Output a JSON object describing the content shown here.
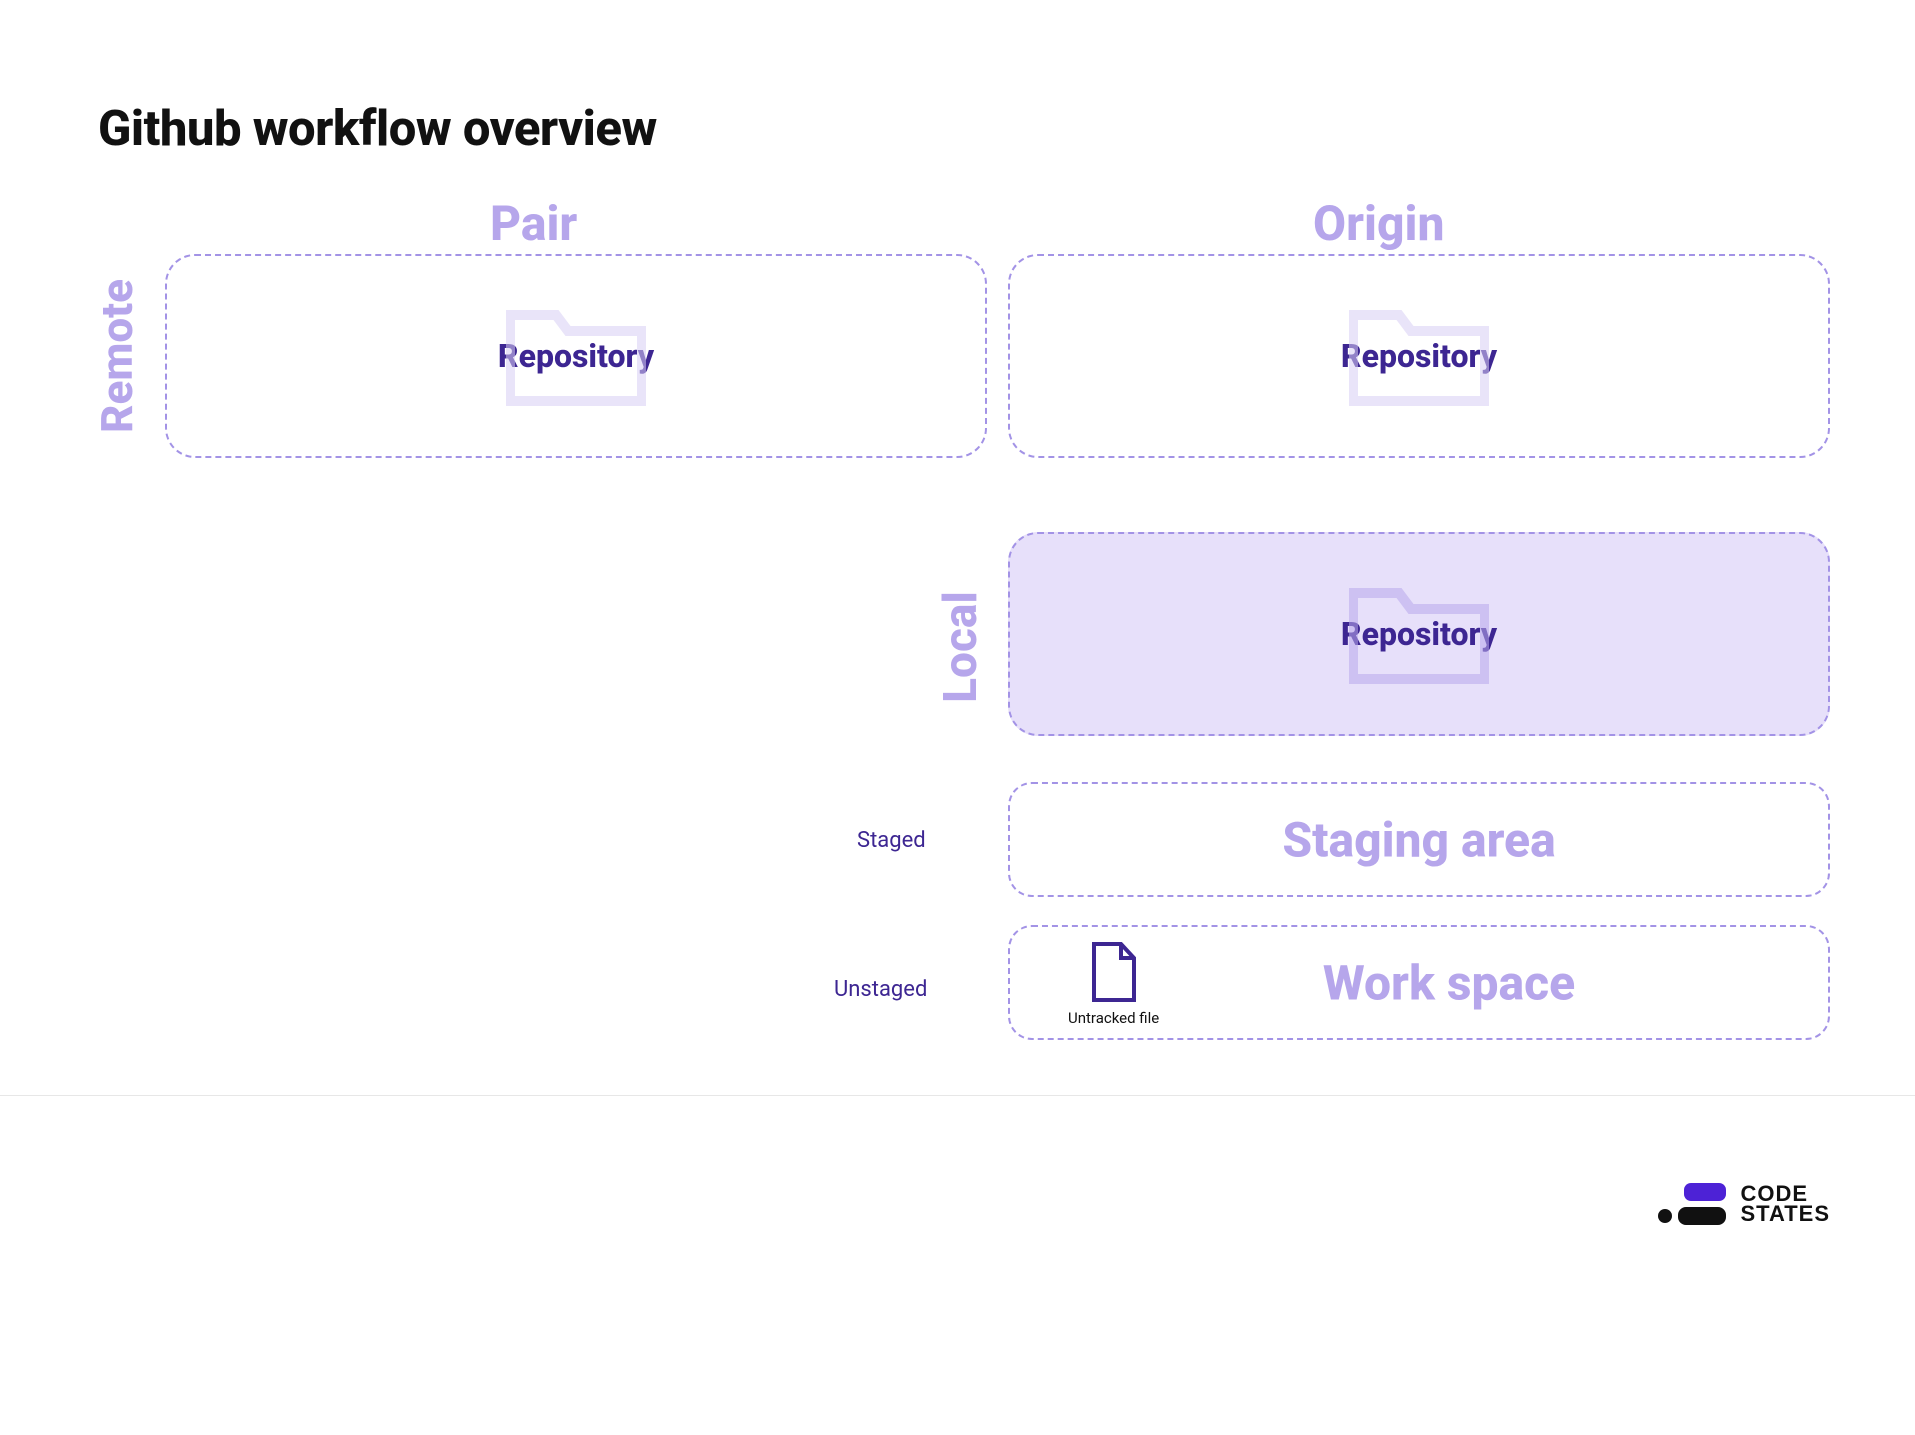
{
  "title": "Github workflow overview",
  "labels": {
    "remote": "Remote",
    "local": "Local",
    "pair": "Pair",
    "origin": "Origin",
    "staged": "Staged",
    "unstaged": "Unstaged"
  },
  "boxes": {
    "pair_repo": "Repository",
    "origin_repo": "Repository",
    "local_repo": "Repository",
    "staging": "Staging area",
    "workspace": "Work space"
  },
  "file": {
    "caption": "Untracked file",
    "icon_name": "file-icon"
  },
  "footer": {
    "brand_line1": "CODE",
    "brand_line2": "STATES"
  },
  "colors": {
    "accent_light": "#b6a6eb",
    "accent_dark": "#3d2692",
    "panel_fill": "#e7e0fa"
  }
}
